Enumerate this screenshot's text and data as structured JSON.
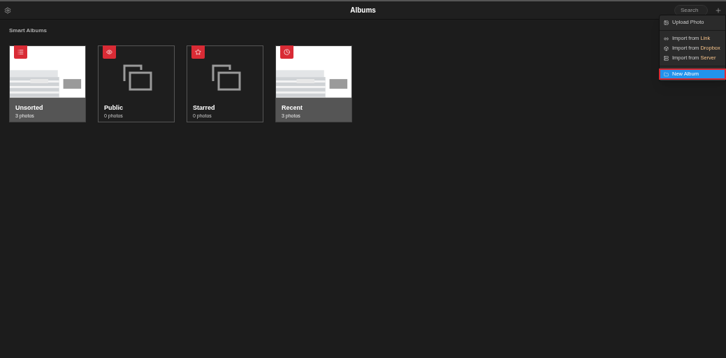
{
  "header": {
    "title": "Albums",
    "search": {
      "placeholder": "Search"
    }
  },
  "section": {
    "title": "Smart Albums"
  },
  "albums": [
    {
      "kind": "picture",
      "title": "Unsorted",
      "count": "3 photos"
    },
    {
      "kind": "empty",
      "title": "Public",
      "count": "0 photos"
    },
    {
      "kind": "empty",
      "title": "Starred",
      "count": "0 photos"
    },
    {
      "kind": "picture",
      "title": "Recent",
      "count": "3 photos"
    }
  ],
  "menu": {
    "items": [
      {
        "kind": "item",
        "text": "Upload Photo",
        "selected": false
      },
      {
        "kind": "divider"
      },
      {
        "kind": "item",
        "text": "Import from ",
        "highlight": "Link",
        "selected": false
      },
      {
        "kind": "item",
        "text": "Import from ",
        "highlight": "Dropbox",
        "selected": false
      },
      {
        "kind": "item",
        "text": "Import from ",
        "highlight": "Server",
        "selected": false
      },
      {
        "kind": "divider"
      },
      {
        "kind": "item",
        "text": "New Album",
        "selected": true
      }
    ]
  }
}
